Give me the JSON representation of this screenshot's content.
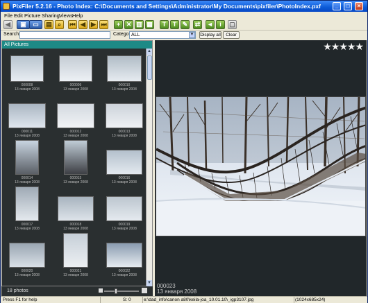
{
  "window": {
    "title": "PixFiler 5.2.16 - Photo Index: C:\\Documents and Settings\\Administrator\\My Documents\\pixfiler\\PhotoIndex.pxf",
    "controls": [
      "_",
      "□",
      "×"
    ]
  },
  "menu": [
    "File",
    "Edit",
    "Picture",
    "Sharing",
    "Views",
    "Help"
  ],
  "toolbar": {
    "buttons": [
      {
        "icon": "back-icon",
        "glyph": "◀"
      },
      {
        "icon": "open-folder-icon",
        "glyph": "▣"
      },
      {
        "icon": "slideshow-icon",
        "glyph": "▭"
      },
      {
        "icon": "print-icon",
        "glyph": "▤"
      },
      {
        "icon": "search-icon",
        "glyph": "⌕"
      },
      {
        "icon": "first-icon",
        "glyph": "⏮"
      },
      {
        "icon": "prev-icon",
        "glyph": "◀"
      },
      {
        "icon": "next-icon",
        "glyph": "▶"
      },
      {
        "icon": "last-icon",
        "glyph": "⏭"
      },
      {
        "icon": "add-icon",
        "glyph": "+"
      },
      {
        "icon": "delete-icon",
        "glyph": "✕"
      },
      {
        "icon": "copy-icon",
        "glyph": "▥"
      },
      {
        "icon": "grid-icon",
        "glyph": "▦"
      },
      {
        "icon": "text-icon",
        "glyph": "T"
      },
      {
        "icon": "tag-icon",
        "glyph": "T"
      },
      {
        "icon": "edit-icon",
        "glyph": "✎"
      },
      {
        "icon": "transfer-icon",
        "glyph": "⇄"
      },
      {
        "icon": "megaphone-icon",
        "glyph": "◄"
      },
      {
        "icon": "info-icon",
        "glyph": "i"
      },
      {
        "icon": "disabled-icon",
        "glyph": "▢"
      }
    ]
  },
  "search": {
    "label": "Search:",
    "value": "",
    "category_label": "Category:",
    "category_value": "ALL",
    "display_all": "Display all",
    "clear": "Clear"
  },
  "left_pane": {
    "header": "All Pictures",
    "count": "18 photos",
    "thumbnails": [
      {
        "id": "000008",
        "date": "13 января 2008"
      },
      {
        "id": "000009",
        "date": "13 января 2008"
      },
      {
        "id": "000010",
        "date": "13 января 2008"
      },
      {
        "id": "000011",
        "date": "13 января 2008"
      },
      {
        "id": "000012",
        "date": "13 января 2008"
      },
      {
        "id": "000013",
        "date": "13 января 2008"
      },
      {
        "id": "000014",
        "date": "13 января 2008"
      },
      {
        "id": "000015",
        "date": "13 января 2008"
      },
      {
        "id": "000016",
        "date": "13 января 2008"
      },
      {
        "id": "000017",
        "date": "13 января 2008"
      },
      {
        "id": "000018",
        "date": "13 января 2008"
      },
      {
        "id": "000019",
        "date": "13 января 2008"
      },
      {
        "id": "000020",
        "date": "13 января 2008"
      },
      {
        "id": "000021",
        "date": "13 января 2008"
      },
      {
        "id": "000022",
        "date": "13 января 2008"
      }
    ]
  },
  "viewer": {
    "rating_stars": 5,
    "photo_id": "000023",
    "photo_date": "13 января 2008"
  },
  "statusbar": {
    "help": "Press F1 for help",
    "selection": "S: 0",
    "path": "e:\\dad_info\\canon a80\\keila-joa_10.01.10\\_igp3107.jpg",
    "dims": "(1024x685x24)"
  }
}
